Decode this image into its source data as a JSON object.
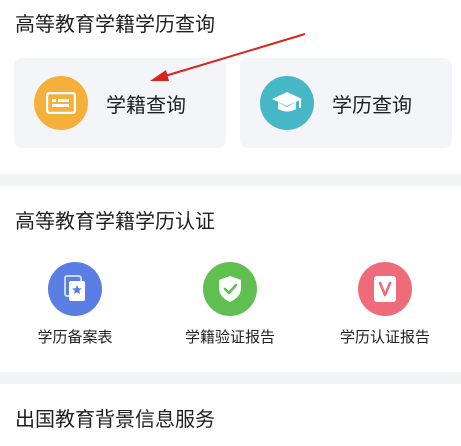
{
  "section_query": {
    "title": "高等教育学籍学历查询",
    "cards": [
      {
        "label": "学籍查询",
        "icon": "student-id-card-icon",
        "color": "#f5b03c"
      },
      {
        "label": "学历查询",
        "icon": "graduation-cap-icon",
        "color": "#45b7c6"
      }
    ]
  },
  "section_certification": {
    "title": "高等教育学籍学历认证",
    "items": [
      {
        "label": "学历备案表",
        "icon": "record-document-icon",
        "color": "#5b7ee5"
      },
      {
        "label": "学籍验证报告",
        "icon": "shield-check-icon",
        "color": "#5fbf51"
      },
      {
        "label": "学历认证报告",
        "icon": "verified-report-icon",
        "color": "#ee6b7a"
      }
    ]
  },
  "section_abroad": {
    "title": "出国教育背景信息服务"
  },
  "annotation": {
    "arrow_color": "#d9241c"
  }
}
